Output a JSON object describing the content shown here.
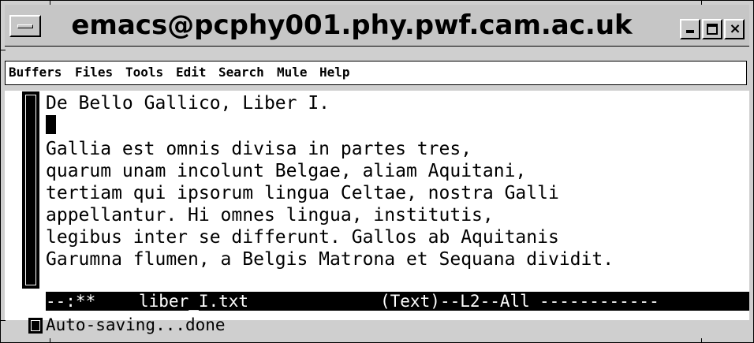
{
  "window": {
    "title": "emacs@pcphy001.phy.pwf.cam.ac.uk",
    "close_glyph": "×"
  },
  "menubar": {
    "items": [
      {
        "label": "Buffers"
      },
      {
        "label": "Files"
      },
      {
        "label": "Tools"
      },
      {
        "label": "Edit"
      },
      {
        "label": "Search"
      },
      {
        "label": "Mule"
      },
      {
        "label": "Help"
      }
    ]
  },
  "buffer": {
    "lines": [
      "De Bello Gallico, Liber I.",
      "",
      "Gallia est omnis divisa in partes tres,",
      "quarum unam incolunt Belgae, aliam Aquitani,",
      "tertiam qui ipsorum lingua Celtae, nostra Galli",
      "appellantur. Hi omnes lingua, institutis,",
      "legibus inter se differunt. Gallos ab Aquitanis",
      "Garumna flumen, a Belgis Matrona et Sequana dividit."
    ]
  },
  "modeline": {
    "status": "--:**",
    "buffer_name": "liber_I.txt",
    "mode": "(Text)",
    "position": "--L2--All",
    "fill": "------------"
  },
  "echo_area": {
    "message": "Auto-saving...done"
  },
  "icons": {
    "window_menu": "window-menu-icon",
    "minimize": "minimize-icon",
    "maximize": "maximize-icon",
    "close": "close-icon"
  }
}
